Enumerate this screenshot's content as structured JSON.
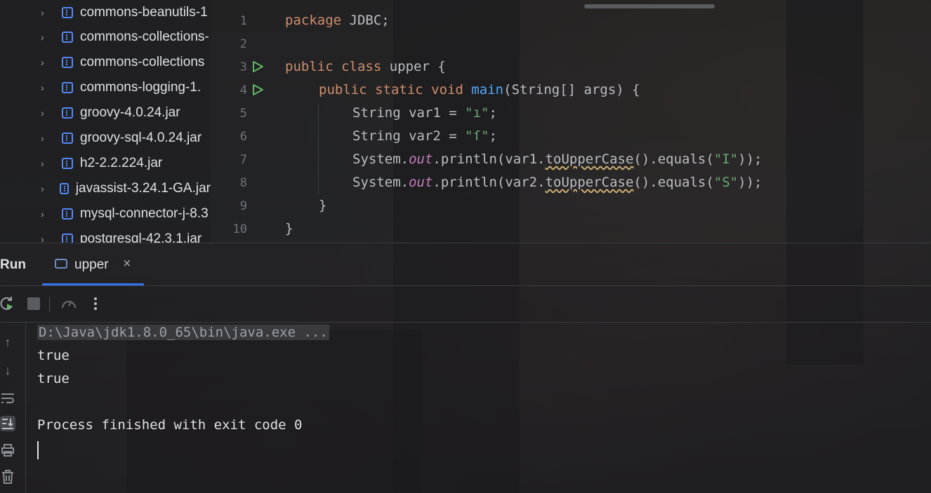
{
  "project_tree": {
    "items": [
      {
        "label": "commons-beanutils-1"
      },
      {
        "label": "commons-collections-"
      },
      {
        "label": "commons-collections"
      },
      {
        "label": "commons-logging-1."
      },
      {
        "label": "groovy-4.0.24.jar"
      },
      {
        "label": "groovy-sql-4.0.24.jar"
      },
      {
        "label": "h2-2.2.224.jar"
      },
      {
        "label": "javassist-3.24.1-GA.jar"
      },
      {
        "label": "mysql-connector-j-8.3"
      },
      {
        "label": "postgresql-42.3.1.jar"
      }
    ]
  },
  "editor": {
    "line_numbers": [
      "1",
      "2",
      "3",
      "4",
      "5",
      "6",
      "7",
      "8",
      "9",
      "10"
    ],
    "code": {
      "l1_kw": "package",
      "l1_rest": " JDBC;",
      "l3_kw1": "public",
      "l3_kw2": "class",
      "l3_rest": " upper {",
      "l4_kw": "public static void",
      "l4_fn": "main",
      "l4_rest": "(String[] args) {",
      "l5_a": "String var1 = ",
      "l5_str": "\"ı\"",
      "l5_b": ";",
      "l6_a": "String var2 = ",
      "l6_str": "\"ſ\"",
      "l6_b": ";",
      "l7_a": "System.",
      "l7_out": "out",
      "l7_b": ".println(var1.",
      "l7_warn": "toUpperCase",
      "l7_c": "().equals(",
      "l7_str": "\"I\"",
      "l7_d": "));",
      "l8_a": "System.",
      "l8_out": "out",
      "l8_b": ".println(var2.",
      "l8_warn": "toUpperCase",
      "l8_c": "().equals(",
      "l8_str": "\"S\"",
      "l8_d": "));",
      "l9": "}",
      "l10": "}"
    }
  },
  "run_panel": {
    "title": "Run",
    "tab_label": "upper",
    "close_glyph": "×",
    "console_lines": {
      "cmd": "D:\\Java\\jdk1.8.0_65\\bin\\java.exe ...",
      "out1": "true",
      "out2": "true",
      "finish": "Process finished with exit code 0"
    }
  },
  "colors": {
    "accent": "#3574f0",
    "keyword": "#cf8e6d",
    "string": "#6aab73",
    "function": "#56a8f5",
    "static_field": "#c77dbb",
    "run_gutter": "#5fb865"
  },
  "icons": [
    "chevron-right-icon",
    "jar-icon",
    "run-gutter-icon",
    "console-tab-icon",
    "close-icon",
    "rerun-icon",
    "stop-icon",
    "profiler-icon",
    "more-icon",
    "scroll-up-icon",
    "scroll-down-icon",
    "soft-wrap-icon",
    "scroll-to-end-icon",
    "print-icon",
    "clear-all-icon"
  ]
}
